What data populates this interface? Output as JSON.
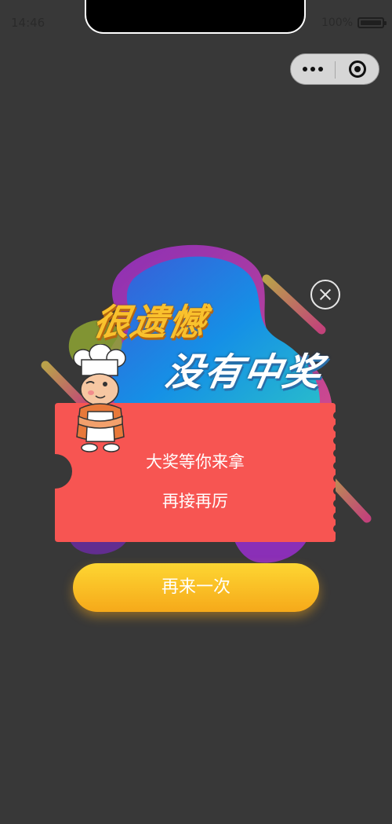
{
  "status_bar": {
    "time": "14:46",
    "battery_text": "100%"
  },
  "capsule": {
    "more_icon": "more-dots-icon",
    "target_icon": "target-icon"
  },
  "popup": {
    "title_line_1": "很遗憾",
    "title_line_2": "没有中奖",
    "ticket_line_1": "大奖等你来拿",
    "ticket_line_2": "再接再厉",
    "button_label": "再来一次",
    "close_icon": "close-circle-icon",
    "mascot": "chef-mascot-illustration"
  },
  "colors": {
    "background": "#383838",
    "ticket": "#f75552",
    "title_primary": "#f9c12d",
    "button_top": "#fdd632",
    "button_bottom": "#f6a91a"
  }
}
